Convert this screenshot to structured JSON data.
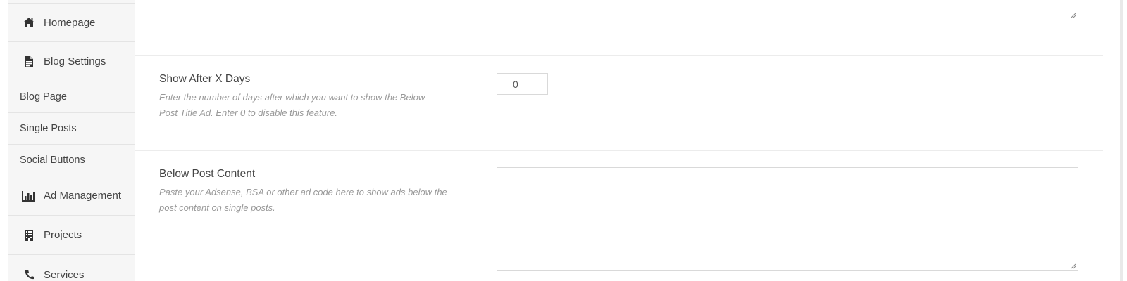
{
  "sidebar": {
    "items": [
      {
        "label": "Homepage",
        "icon": "home-icon"
      },
      {
        "label": "Blog Settings",
        "icon": "document-icon"
      },
      {
        "label": "Blog Page"
      },
      {
        "label": "Single Posts"
      },
      {
        "label": "Social Buttons"
      },
      {
        "label": "Ad Management",
        "icon": "bar-chart-icon"
      },
      {
        "label": "Projects",
        "icon": "building-icon"
      },
      {
        "label": "Services",
        "icon": "phone-icon"
      }
    ]
  },
  "fields": {
    "show_after": {
      "title": "Show After X Days",
      "description": "Enter the number of days after which you want to show the Below Post Title Ad. Enter 0 to disable this feature.",
      "value": "0"
    },
    "below_post_content": {
      "title": "Below Post Content",
      "description": "Paste your Adsense, BSA or other ad code here to show ads below the post content on single posts.",
      "value": ""
    }
  }
}
